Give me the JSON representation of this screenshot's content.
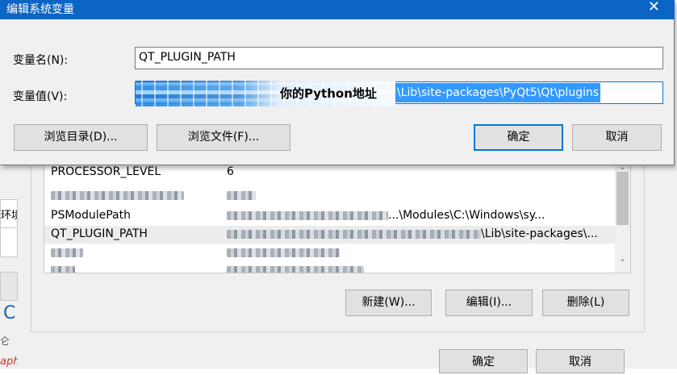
{
  "edit_dialog": {
    "title": "编辑系统变量",
    "close_glyph": "✕",
    "name_label": "变量名(N):",
    "name_value": "QT_PLUGIN_PATH",
    "value_label": "变量值(V):",
    "value_overlay_note": "你的Python地址",
    "value_selected_text": "\\Lib\\site-packages\\PyQt5\\Qt\\plugins",
    "browse_dir_label": "浏览目录(D)...",
    "browse_file_label": "浏览文件(F)...",
    "ok_label": "确定",
    "cancel_label": "取消"
  },
  "env_dialog": {
    "system_vars": [
      {
        "name": "PROCESSOR_LEVEL",
        "value": "6"
      },
      {
        "name": "",
        "value": ""
      },
      {
        "name": "PSModulePath",
        "value": "...\\Modules\\C:\\Windows\\sy..."
      },
      {
        "name": "QT_PLUGIN_PATH",
        "value": "\\Lib\\site-packages\\..."
      },
      {
        "name": "",
        "value": ""
      },
      {
        "name": "",
        "value": ""
      }
    ],
    "new_label": "新建(W)...",
    "edit_label": "编辑(I)...",
    "delete_label": "删除(L)",
    "ok_label": "确定",
    "cancel_label": "取消",
    "scroll_up_glyph": "˄",
    "scroll_down_glyph": "˅"
  },
  "left_panel": {
    "cell_text": "环境",
    "blue_char": "C",
    "small_char": "仑",
    "red_text": "aph"
  },
  "colors": {
    "title_bar": "#0c64c4",
    "selection": "#3399ff",
    "primary_border": "#0078d7"
  }
}
